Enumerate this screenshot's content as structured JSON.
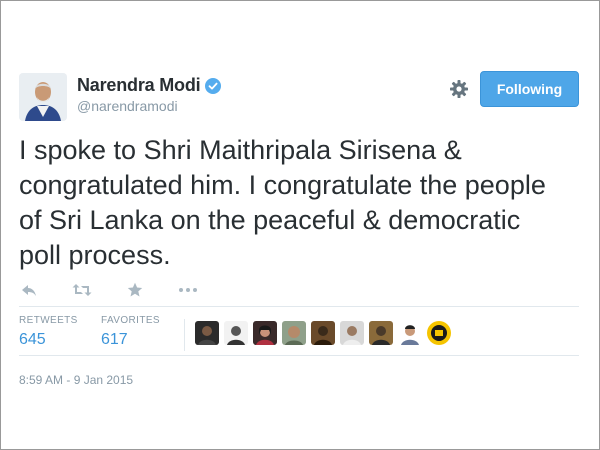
{
  "user": {
    "name": "Narendra Modi",
    "handle": "@narendramodi",
    "verified": true,
    "avatar_icon": "user-avatar"
  },
  "follow_button": {
    "label": "Following",
    "color": "#4ea6e8"
  },
  "tweet": {
    "text": "I spoke to Shri Maithripala Sirisena & congratulated him. I congratulate the people of Sri Lanka on the peaceful & democratic poll process."
  },
  "actions": [
    "reply-icon",
    "retweet-icon",
    "favorite-icon",
    "more-icon"
  ],
  "stats": {
    "retweets_label": "RETWEETS",
    "retweets_value": "645",
    "favorites_label": "FAVORITES",
    "favorites_value": "617"
  },
  "favoriters_count_shown": 9,
  "timestamp": "8:59 AM - 9 Jan 2015",
  "colors": {
    "accent": "#55acee",
    "link": "#3b94d9",
    "muted": "#8899a6",
    "text": "#292f33",
    "divider": "#e1e8ed"
  }
}
